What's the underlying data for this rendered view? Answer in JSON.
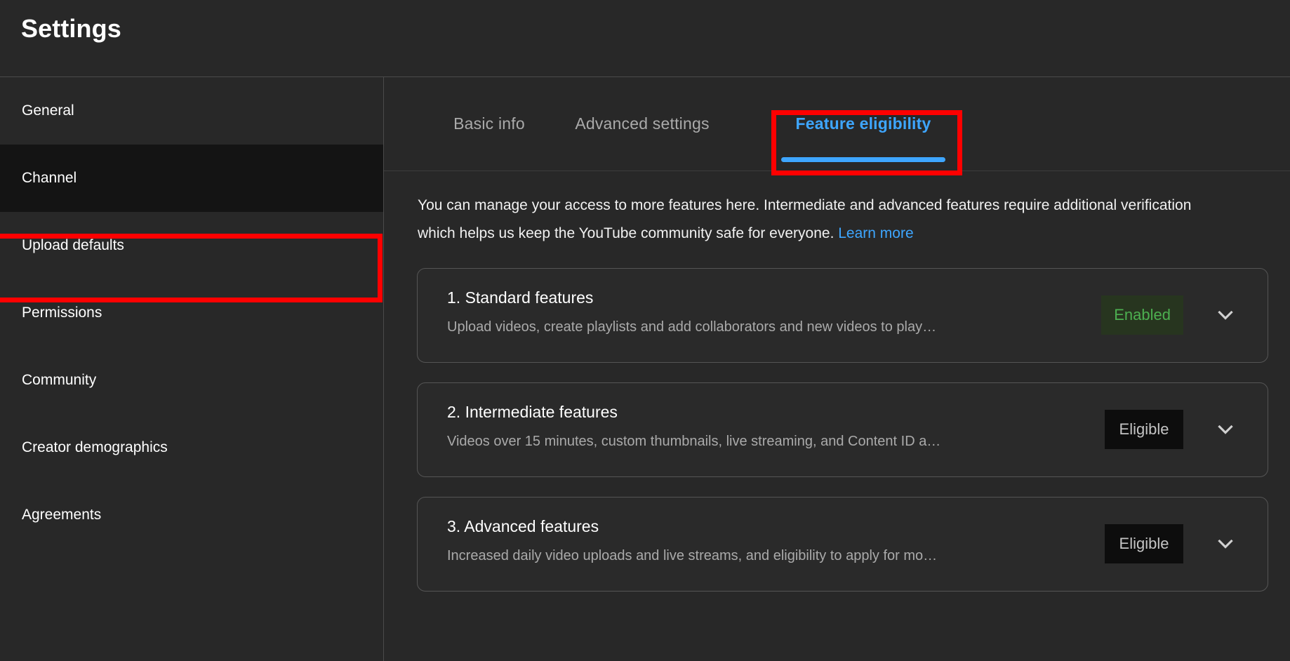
{
  "header": {
    "title": "Settings"
  },
  "sidebar": {
    "items": [
      {
        "label": "General",
        "selected": false
      },
      {
        "label": "Channel",
        "selected": true
      },
      {
        "label": "Upload defaults",
        "selected": false
      },
      {
        "label": "Permissions",
        "selected": false
      },
      {
        "label": "Community",
        "selected": false
      },
      {
        "label": "Creator demographics",
        "selected": false
      },
      {
        "label": "Agreements",
        "selected": false
      }
    ]
  },
  "tabs": [
    {
      "label": "Basic info",
      "active": false
    },
    {
      "label": "Advanced settings",
      "active": false
    },
    {
      "label": "Feature eligibility",
      "active": true
    }
  ],
  "intro": {
    "text": "You can manage your access to more features here. Intermediate and advanced features require additional verification which helps us keep the YouTube community safe for everyone. ",
    "link_label": "Learn more"
  },
  "cards": [
    {
      "title": "1. Standard features",
      "description": "Upload videos, create playlists and add collaborators and new videos to play…",
      "badge": "Enabled",
      "badge_state": "enabled",
      "chevron": "chevron-down-icon"
    },
    {
      "title": "2. Intermediate features",
      "description": "Videos over 15 minutes, custom thumbnails, live streaming, and Content ID a…",
      "badge": "Eligible",
      "badge_state": "eligible",
      "chevron": "chevron-down-icon"
    },
    {
      "title": "3. Advanced features",
      "description": "Increased daily video uploads and live streams, and eligibility to apply for mo…",
      "badge": "Eligible",
      "badge_state": "eligible",
      "chevron": "chevron-down-icon"
    }
  ],
  "annotations": {
    "highlight_color": "#ff0000",
    "boxes": [
      {
        "target": "sidebar-item-channel"
      },
      {
        "target": "tab-feature-eligibility"
      }
    ]
  },
  "colors": {
    "background": "#282828",
    "selected_nav": "#141414",
    "accent_blue": "#3ea6ff",
    "enabled_green": "#4caf50",
    "enabled_green_bg": "#27351f",
    "eligible_bg": "#0d0d0d",
    "muted_text": "#aaaaaa",
    "divider": "#4a4a4a"
  }
}
